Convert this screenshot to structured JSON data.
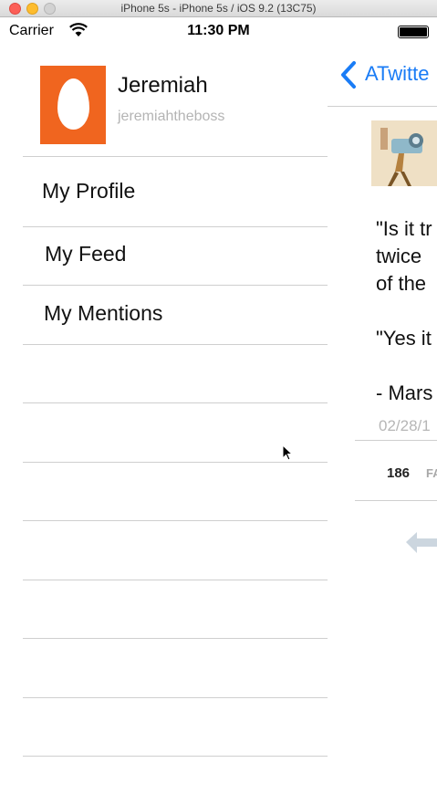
{
  "window": {
    "title": "iPhone 5s - iPhone 5s / iOS 9.2 (13C75)"
  },
  "status_bar": {
    "carrier": "Carrier",
    "time": "11:30 PM",
    "battery_level": 1.0
  },
  "menu": {
    "profile": {
      "name": "Jeremiah",
      "handle": "jeremiahtheboss",
      "avatar_color": "#f0651f"
    },
    "items": [
      {
        "label": "My Profile"
      },
      {
        "label": "My Feed"
      },
      {
        "label": "My Mentions"
      }
    ]
  },
  "detail": {
    "back_label": "ATwitte",
    "accent_color": "#1a7cf6",
    "tweet_lines": [
      "\"Is it tr",
      "twice",
      "of the",
      "",
      "\"Yes it",
      "",
      "- Mars"
    ],
    "date": "02/28/1",
    "favorites_count": "186",
    "favorites_label": "FA"
  }
}
